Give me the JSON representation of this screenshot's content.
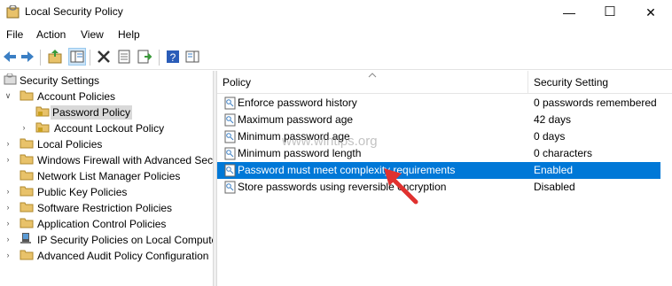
{
  "window": {
    "title": "Local Security Policy",
    "minimize_glyph": "—",
    "maximize_glyph": "☐",
    "close_glyph": "✕"
  },
  "menu": [
    "File",
    "Action",
    "View",
    "Help"
  ],
  "toolbar_icons": [
    "back-icon",
    "forward-icon",
    "up-folder-icon",
    "show-hide-tree-icon",
    "delete-icon",
    "properties-icon",
    "export-list-icon",
    "help-icon",
    "show-hide-pane-icon"
  ],
  "tree": {
    "root": "Security Settings",
    "items": [
      {
        "label": "Account Policies",
        "expanded": true,
        "level": 1
      },
      {
        "label": "Password Policy",
        "level": 2,
        "selected": true
      },
      {
        "label": "Account Lockout Policy",
        "level": 2
      },
      {
        "label": "Local Policies",
        "level": 1
      },
      {
        "label": "Windows Firewall with Advanced Security",
        "level": 1
      },
      {
        "label": "Network List Manager Policies",
        "level": 1
      },
      {
        "label": "Public Key Policies",
        "level": 1
      },
      {
        "label": "Software Restriction Policies",
        "level": 1
      },
      {
        "label": "Application Control Policies",
        "level": 1
      },
      {
        "label": "IP Security Policies on Local Computer",
        "level": 1
      },
      {
        "label": "Advanced Audit Policy Configuration",
        "level": 1
      }
    ]
  },
  "list": {
    "columns": [
      "Policy",
      "Security Setting"
    ],
    "rows": [
      {
        "policy": "Enforce password history",
        "setting": "0 passwords remembered"
      },
      {
        "policy": "Maximum password age",
        "setting": "42 days"
      },
      {
        "policy": "Minimum password age",
        "setting": "0 days"
      },
      {
        "policy": "Minimum password length",
        "setting": "0 characters"
      },
      {
        "policy": "Password must meet complexity requirements",
        "setting": "Enabled",
        "selected": true
      },
      {
        "policy": "Store passwords using reversible encryption",
        "setting": "Disabled"
      }
    ]
  },
  "watermark": "www.wintips.org",
  "colors": {
    "selection": "#0078d7",
    "tree_selection": "#d9d9d9",
    "arrow": "#e0312f"
  }
}
